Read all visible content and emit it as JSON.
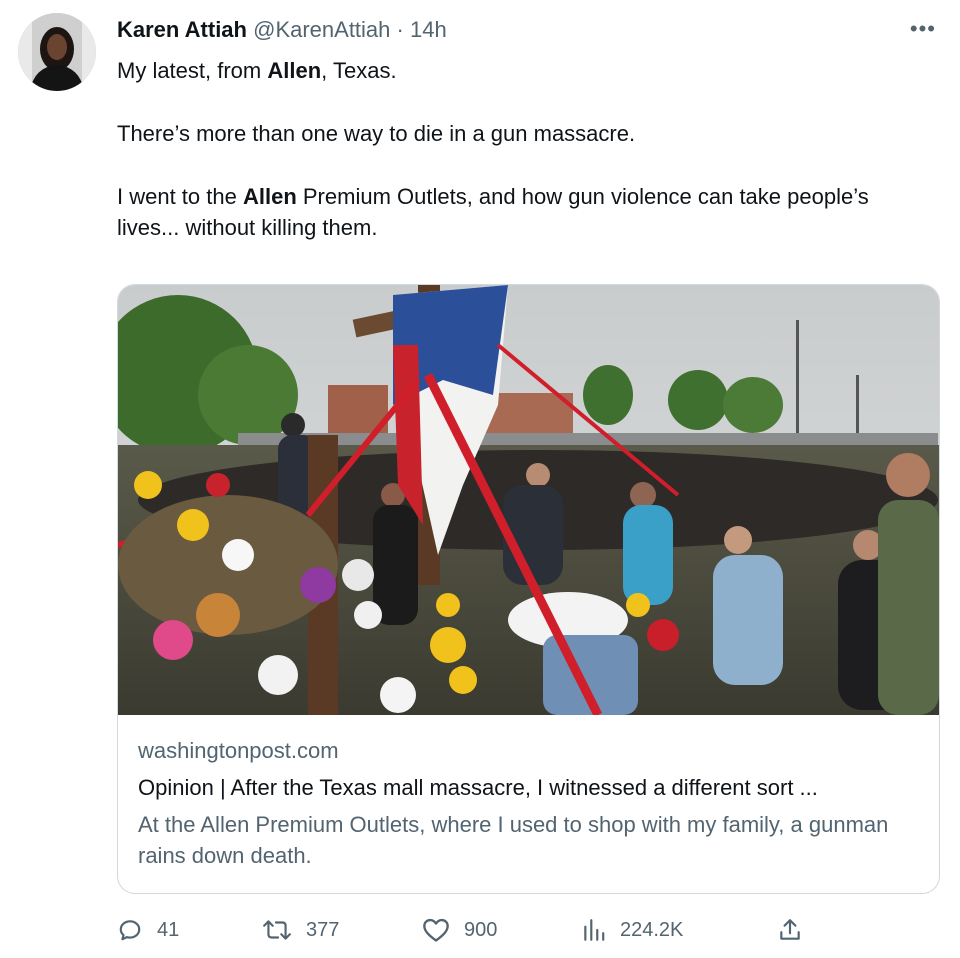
{
  "tweet": {
    "author_name": "Karen Attiah",
    "handle": "@KarenAttiah",
    "separator": "·",
    "time": "14h",
    "more_label": "•••",
    "paragraph1": {
      "before": "My latest, from ",
      "bold": "Allen",
      "after": ", Texas."
    },
    "paragraph2": "There’s more than one way to die in a gun massacre.",
    "paragraph3": {
      "before": "I went to the ",
      "bold": "Allen",
      "after": " Premium Outlets, and how gun violence can take people’s lives... without killing them."
    }
  },
  "card": {
    "domain": "washingtonpost.com",
    "title": "Opinion | After the Texas mall massacre, I witnessed a different sort ...",
    "description": "At the Allen Premium Outlets, where I used to shop with my family, a gunman rains down death."
  },
  "actions": {
    "replies": "41",
    "retweets": "377",
    "likes": "900",
    "views": "224.2K"
  },
  "colors": {
    "text": "#0f1419",
    "secondary": "#536471",
    "border": "#cfd9de"
  }
}
